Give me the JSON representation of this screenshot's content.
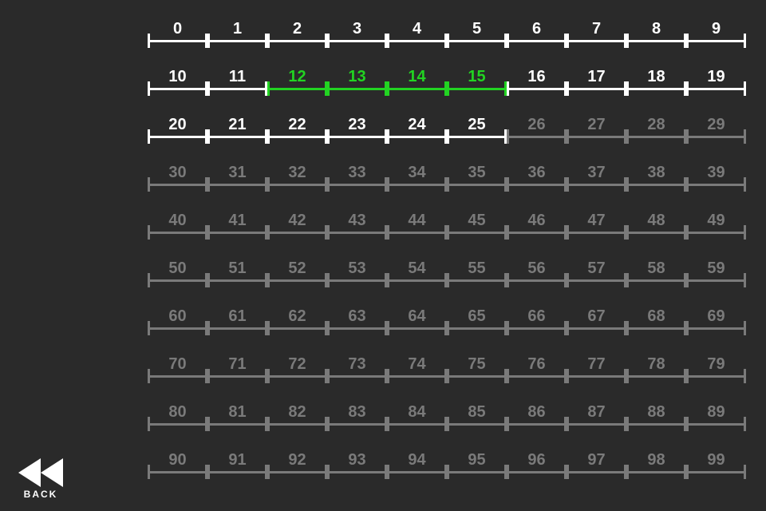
{
  "back_label": "BACK",
  "colors": {
    "unlocked": "#ffffff",
    "highlight": "#22d322",
    "locked": "#7a7a7a",
    "bg": "#2a2a2a"
  },
  "levels": [
    {
      "n": 0,
      "s": "white"
    },
    {
      "n": 1,
      "s": "white"
    },
    {
      "n": 2,
      "s": "white"
    },
    {
      "n": 3,
      "s": "white"
    },
    {
      "n": 4,
      "s": "white"
    },
    {
      "n": 5,
      "s": "white"
    },
    {
      "n": 6,
      "s": "white"
    },
    {
      "n": 7,
      "s": "white"
    },
    {
      "n": 8,
      "s": "white"
    },
    {
      "n": 9,
      "s": "white"
    },
    {
      "n": 10,
      "s": "white"
    },
    {
      "n": 11,
      "s": "white"
    },
    {
      "n": 12,
      "s": "green"
    },
    {
      "n": 13,
      "s": "green"
    },
    {
      "n": 14,
      "s": "green"
    },
    {
      "n": 15,
      "s": "green"
    },
    {
      "n": 16,
      "s": "white"
    },
    {
      "n": 17,
      "s": "white"
    },
    {
      "n": 18,
      "s": "white"
    },
    {
      "n": 19,
      "s": "white"
    },
    {
      "n": 20,
      "s": "white"
    },
    {
      "n": 21,
      "s": "white"
    },
    {
      "n": 22,
      "s": "white"
    },
    {
      "n": 23,
      "s": "white"
    },
    {
      "n": 24,
      "s": "white"
    },
    {
      "n": 25,
      "s": "white"
    },
    {
      "n": 26,
      "s": "grey"
    },
    {
      "n": 27,
      "s": "grey"
    },
    {
      "n": 28,
      "s": "grey"
    },
    {
      "n": 29,
      "s": "grey"
    },
    {
      "n": 30,
      "s": "grey"
    },
    {
      "n": 31,
      "s": "grey"
    },
    {
      "n": 32,
      "s": "grey"
    },
    {
      "n": 33,
      "s": "grey"
    },
    {
      "n": 34,
      "s": "grey"
    },
    {
      "n": 35,
      "s": "grey"
    },
    {
      "n": 36,
      "s": "grey"
    },
    {
      "n": 37,
      "s": "grey"
    },
    {
      "n": 38,
      "s": "grey"
    },
    {
      "n": 39,
      "s": "grey"
    },
    {
      "n": 40,
      "s": "grey"
    },
    {
      "n": 41,
      "s": "grey"
    },
    {
      "n": 42,
      "s": "grey"
    },
    {
      "n": 43,
      "s": "grey"
    },
    {
      "n": 44,
      "s": "grey"
    },
    {
      "n": 45,
      "s": "grey"
    },
    {
      "n": 46,
      "s": "grey"
    },
    {
      "n": 47,
      "s": "grey"
    },
    {
      "n": 48,
      "s": "grey"
    },
    {
      "n": 49,
      "s": "grey"
    },
    {
      "n": 50,
      "s": "grey"
    },
    {
      "n": 51,
      "s": "grey"
    },
    {
      "n": 52,
      "s": "grey"
    },
    {
      "n": 53,
      "s": "grey"
    },
    {
      "n": 54,
      "s": "grey"
    },
    {
      "n": 55,
      "s": "grey"
    },
    {
      "n": 56,
      "s": "grey"
    },
    {
      "n": 57,
      "s": "grey"
    },
    {
      "n": 58,
      "s": "grey"
    },
    {
      "n": 59,
      "s": "grey"
    },
    {
      "n": 60,
      "s": "grey"
    },
    {
      "n": 61,
      "s": "grey"
    },
    {
      "n": 62,
      "s": "grey"
    },
    {
      "n": 63,
      "s": "grey"
    },
    {
      "n": 64,
      "s": "grey"
    },
    {
      "n": 65,
      "s": "grey"
    },
    {
      "n": 66,
      "s": "grey"
    },
    {
      "n": 67,
      "s": "grey"
    },
    {
      "n": 68,
      "s": "grey"
    },
    {
      "n": 69,
      "s": "grey"
    },
    {
      "n": 70,
      "s": "grey"
    },
    {
      "n": 71,
      "s": "grey"
    },
    {
      "n": 72,
      "s": "grey"
    },
    {
      "n": 73,
      "s": "grey"
    },
    {
      "n": 74,
      "s": "grey"
    },
    {
      "n": 75,
      "s": "grey"
    },
    {
      "n": 76,
      "s": "grey"
    },
    {
      "n": 77,
      "s": "grey"
    },
    {
      "n": 78,
      "s": "grey"
    },
    {
      "n": 79,
      "s": "grey"
    },
    {
      "n": 80,
      "s": "grey"
    },
    {
      "n": 81,
      "s": "grey"
    },
    {
      "n": 82,
      "s": "grey"
    },
    {
      "n": 83,
      "s": "grey"
    },
    {
      "n": 84,
      "s": "grey"
    },
    {
      "n": 85,
      "s": "grey"
    },
    {
      "n": 86,
      "s": "grey"
    },
    {
      "n": 87,
      "s": "grey"
    },
    {
      "n": 88,
      "s": "grey"
    },
    {
      "n": 89,
      "s": "grey"
    },
    {
      "n": 90,
      "s": "grey"
    },
    {
      "n": 91,
      "s": "grey"
    },
    {
      "n": 92,
      "s": "grey"
    },
    {
      "n": 93,
      "s": "grey"
    },
    {
      "n": 94,
      "s": "grey"
    },
    {
      "n": 95,
      "s": "grey"
    },
    {
      "n": 96,
      "s": "grey"
    },
    {
      "n": 97,
      "s": "grey"
    },
    {
      "n": 98,
      "s": "grey"
    },
    {
      "n": 99,
      "s": "grey"
    }
  ]
}
